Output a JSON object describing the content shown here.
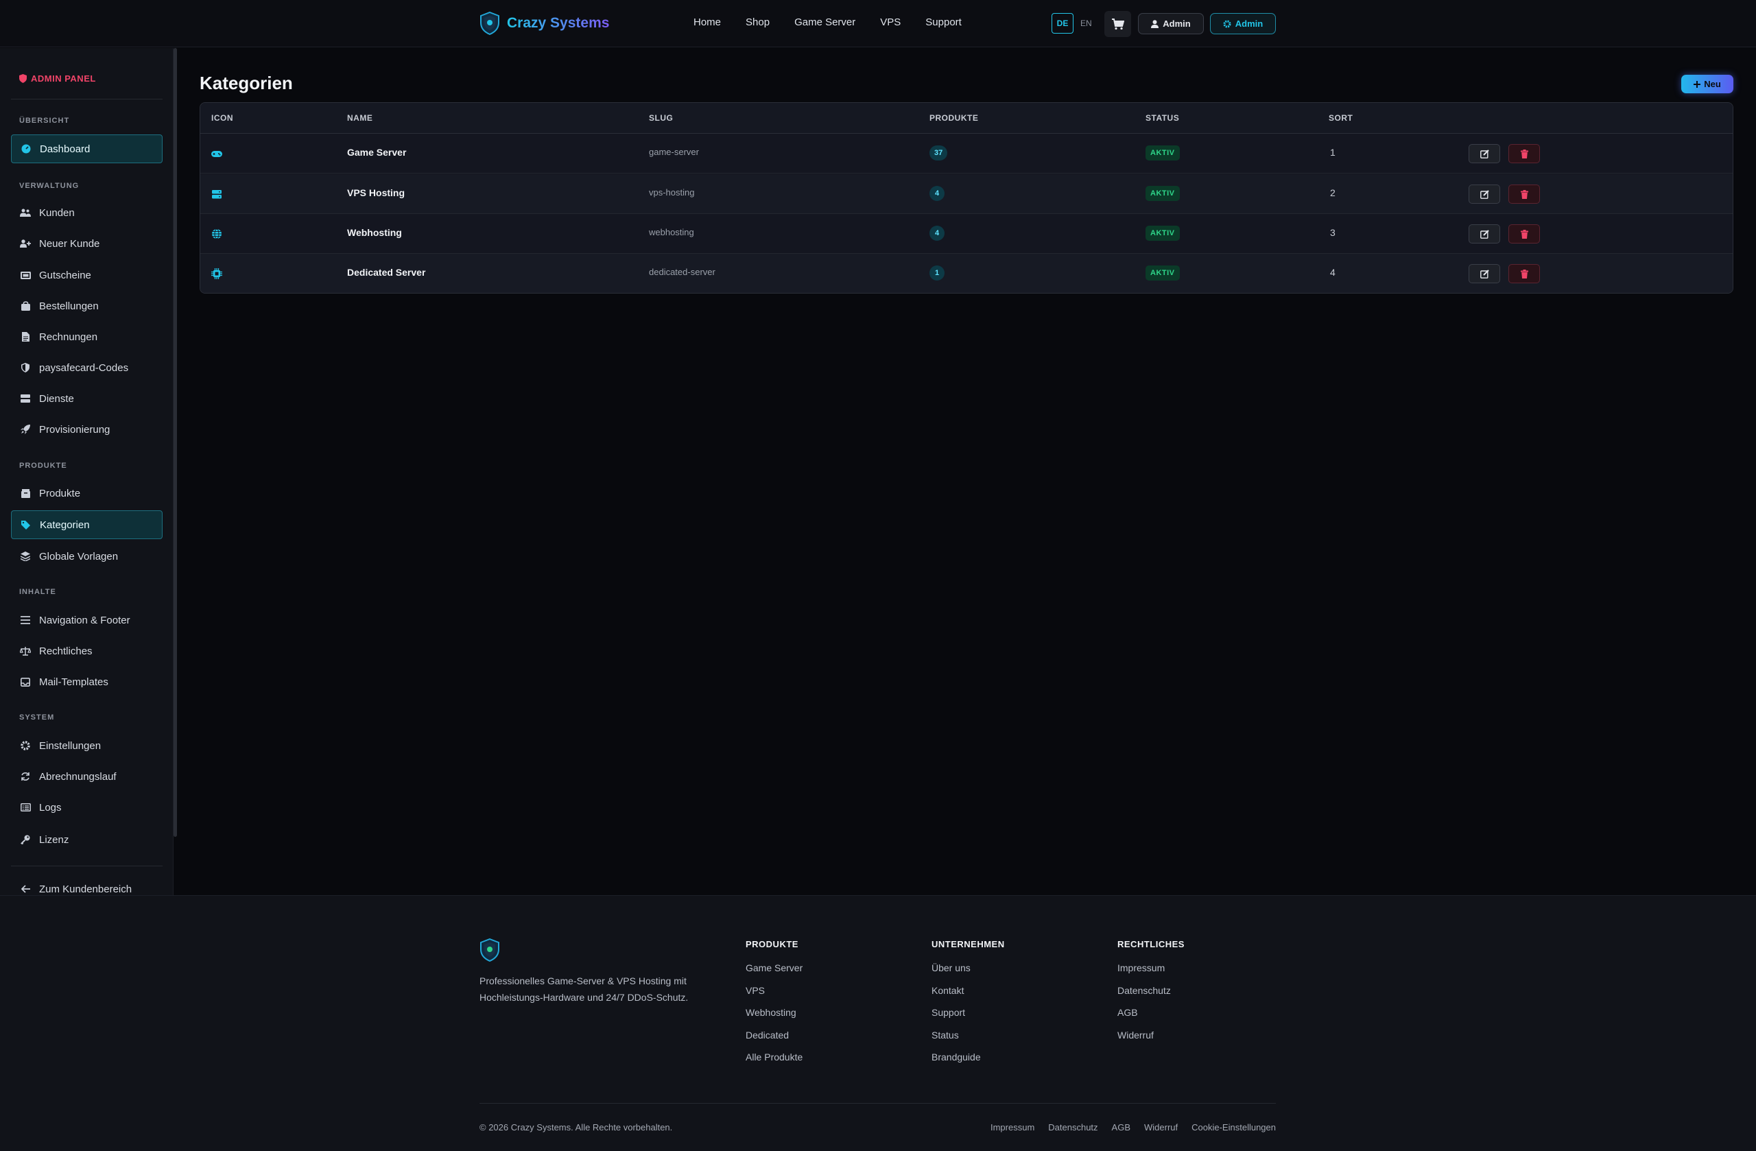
{
  "header": {
    "brand": "Crazy Systems",
    "nav": [
      "Home",
      "Shop",
      "Game Server",
      "VPS",
      "Support"
    ],
    "lang_de": "DE",
    "lang_en": "EN",
    "user_label": "Admin",
    "admin_label": "Admin"
  },
  "sidebar": {
    "title": "ADMIN PANEL",
    "sections": {
      "overview": "ÜBERSICHT",
      "verwaltung": "VERWALTUNG",
      "produkte": "PRODUKTE",
      "inhalte": "INHALTE",
      "system": "SYSTEM"
    },
    "items": {
      "dashboard": "Dashboard",
      "kunden": "Kunden",
      "neuer_kunde": "Neuer Kunde",
      "gutscheine": "Gutscheine",
      "bestellungen": "Bestellungen",
      "rechnungen": "Rechnungen",
      "paysafecard": "paysafecard-Codes",
      "dienste": "Dienste",
      "provisionierung": "Provisionierung",
      "produkte": "Produkte",
      "kategorien": "Kategorien",
      "globale_vorlagen": "Globale Vorlagen",
      "navigation_footer": "Navigation & Footer",
      "rechtliches": "Rechtliches",
      "mail_templates": "Mail-Templates",
      "einstellungen": "Einstellungen",
      "abrechnungslauf": "Abrechnungslauf",
      "logs": "Logs",
      "lizenz": "Lizenz",
      "kundenbereich": "Zum Kundenbereich"
    }
  },
  "main": {
    "title": "Kategorien",
    "new_button": "Neu",
    "columns": {
      "icon": "ICON",
      "name": "NAME",
      "slug": "SLUG",
      "produkte": "PRODUKTE",
      "status": "STATUS",
      "sort": "SORT"
    },
    "rows": [
      {
        "icon": "gamepad-icon",
        "name": "Game Server",
        "slug": "game-server",
        "count": "37",
        "status": "AKTIV",
        "sort": "1"
      },
      {
        "icon": "server-icon",
        "name": "VPS Hosting",
        "slug": "vps-hosting",
        "count": "4",
        "status": "AKTIV",
        "sort": "2"
      },
      {
        "icon": "globe-icon",
        "name": "Webhosting",
        "slug": "webhosting",
        "count": "4",
        "status": "AKTIV",
        "sort": "3"
      },
      {
        "icon": "cpu-icon",
        "name": "Dedicated Server",
        "slug": "dedicated-server",
        "count": "1",
        "status": "AKTIV",
        "sort": "4"
      }
    ]
  },
  "footer": {
    "description": "Professionelles Game-Server & VPS Hosting mit Hochleistungs-Hardware und 24/7 DDoS-Schutz.",
    "cols": [
      {
        "heading": "PRODUKTE",
        "links": [
          "Game Server",
          "VPS",
          "Webhosting",
          "Dedicated",
          "Alle Produkte"
        ]
      },
      {
        "heading": "UNTERNEHMEN",
        "links": [
          "Über uns",
          "Kontakt",
          "Support",
          "Status",
          "Brandguide"
        ]
      },
      {
        "heading": "RECHTLICHES",
        "links": [
          "Impressum",
          "Datenschutz",
          "AGB",
          "Widerruf"
        ]
      }
    ],
    "copyright": "© 2026 Crazy Systems. Alle Rechte vorbehalten.",
    "bottom_links": [
      "Impressum",
      "Datenschutz",
      "AGB",
      "Widerruf",
      "Cookie-Einstellungen"
    ]
  },
  "colors": {
    "accent": "#22c5e8",
    "brand_purple": "#7c5cf5",
    "danger": "#f04468",
    "success": "#2fd58a",
    "background": "#08090d"
  }
}
